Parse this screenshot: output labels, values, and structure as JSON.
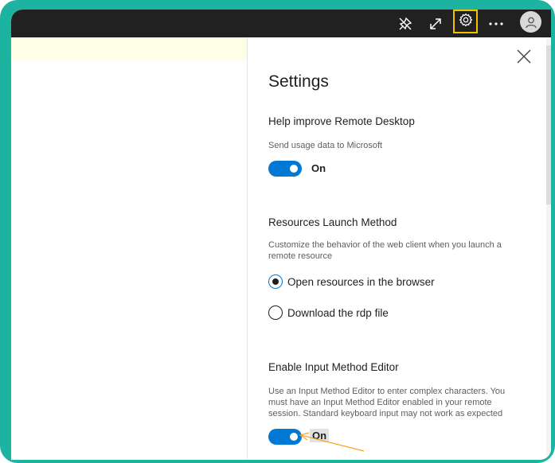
{
  "colors": {
    "frame": "#1cb3a1",
    "topbar": "#212121",
    "accent": "#0078d4",
    "highlight_box": "#f2c200",
    "arrow": "#f5a623"
  },
  "toolbar": {
    "icons": [
      "pin-icon",
      "expand-icon",
      "gear-icon",
      "more-icon",
      "avatar"
    ]
  },
  "settings": {
    "title": "Settings",
    "telemetry": {
      "heading": "Help improve Remote Desktop",
      "description": "Send usage data to Microsoft",
      "toggle_state": "On"
    },
    "launch": {
      "heading": "Resources Launch Method",
      "description": "Customize the behavior of the web client when you launch a remote resource",
      "options": [
        {
          "label": "Open resources in the browser",
          "selected": true
        },
        {
          "label": "Download the rdp file",
          "selected": false
        }
      ]
    },
    "ime": {
      "heading": "Enable Input Method Editor",
      "description": "Use an Input Method Editor to enter complex characters. You must have an Input Method Editor enabled in your remote session. Standard keyboard input may not work as expected",
      "toggle_state": "On"
    }
  }
}
